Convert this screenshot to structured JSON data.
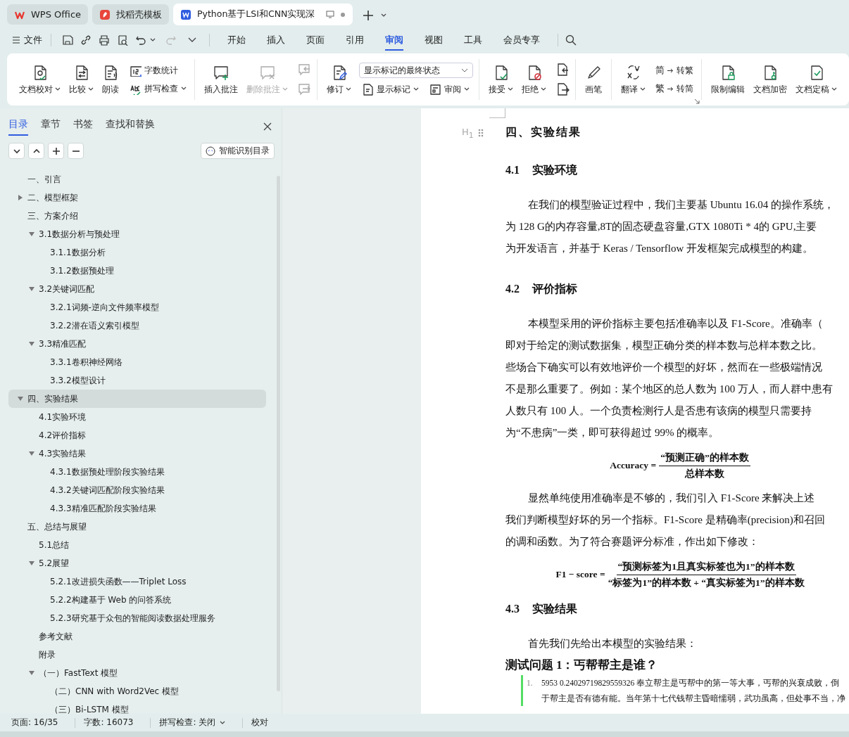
{
  "browser_tabs": [
    {
      "title": "WPS Office",
      "selected": false
    },
    {
      "title": "找稻壳模板",
      "selected": false
    },
    {
      "title": "Python基于LSI和CNN实现深",
      "selected": true
    }
  ],
  "menu": {
    "file": "文件",
    "tabs": [
      {
        "label": "开始",
        "selected": false
      },
      {
        "label": "插入",
        "selected": false
      },
      {
        "label": "页面",
        "selected": false
      },
      {
        "label": "引用",
        "selected": false
      },
      {
        "label": "审阅",
        "selected": true
      },
      {
        "label": "视图",
        "selected": false
      },
      {
        "label": "工具",
        "selected": false
      },
      {
        "label": "会员专享",
        "selected": false
      }
    ]
  },
  "ribbon": {
    "groups": [
      [
        {
          "kind": "large",
          "label": "文档校对",
          "dropdown": true,
          "disabled": false
        },
        {
          "kind": "large",
          "label": "比较",
          "dropdown": true,
          "disabled": false
        },
        {
          "kind": "large",
          "label": "朗读",
          "dropdown": false,
          "disabled": false
        },
        {
          "kind": "stack",
          "items": [
            {
              "label": "字数统计",
              "dropdown": false
            },
            {
              "label": "拼写检查",
              "dropdown": true
            }
          ]
        }
      ],
      [
        {
          "kind": "large",
          "label": "插入批注",
          "dropdown": false,
          "disabled": false
        },
        {
          "kind": "large",
          "label": "删除批注",
          "dropdown": true,
          "disabled": true
        },
        {
          "kind": "icons",
          "disabled": true
        }
      ],
      [
        {
          "kind": "large",
          "label": "修订",
          "dropdown": true,
          "disabled": false
        },
        {
          "kind": "select_stack",
          "value": "显示标记的最终状态",
          "items": [
            {
              "label": "显示标记",
              "dropdown": true
            },
            {
              "label": "审阅",
              "dropdown": true
            }
          ]
        }
      ],
      [
        {
          "kind": "large",
          "label": "接受",
          "dropdown": true,
          "disabled": false
        },
        {
          "kind": "large",
          "label": "拒绝",
          "dropdown": true,
          "disabled": false
        },
        {
          "kind": "icons",
          "disabled": false
        }
      ],
      [
        {
          "kind": "large",
          "label": "画笔",
          "dropdown": false,
          "disabled": false
        }
      ],
      [
        {
          "kind": "large",
          "label": "翻译",
          "dropdown": true,
          "disabled": false
        },
        {
          "kind": "stack",
          "items": [
            {
              "glyph": "简",
              "label": "转繁",
              "dropdown": false
            },
            {
              "glyph": "繁",
              "label": "转简",
              "dropdown": false
            }
          ]
        }
      ],
      [
        {
          "kind": "large",
          "label": "限制编辑",
          "dropdown": false,
          "disabled": false
        },
        {
          "kind": "large",
          "label": "文档加密",
          "dropdown": false,
          "disabled": false
        },
        {
          "kind": "large",
          "label": "文档定稿",
          "dropdown": true,
          "disabled": false
        }
      ]
    ]
  },
  "nav": {
    "tabs": [
      {
        "label": "目录",
        "selected": true
      },
      {
        "label": "章节",
        "selected": false
      },
      {
        "label": "书签",
        "selected": false
      },
      {
        "label": "查找和替换",
        "selected": false
      }
    ],
    "smart_button": "智能识别目录",
    "tree": [
      {
        "label": "一、引言",
        "selected": false
      },
      {
        "label": "二、模型框架",
        "selected": false,
        "expanded": false
      },
      {
        "label": "三、方案介绍",
        "selected": false,
        "children": [
          {
            "label": "3.1数据分析与预处理",
            "selected": false,
            "expanded": true,
            "children": [
              {
                "label": "3.1.1数据分析",
                "selected": false
              },
              {
                "label": "3.1.2数据预处理",
                "selected": false
              }
            ]
          },
          {
            "label": "3.2关键词匹配",
            "selected": false,
            "expanded": true,
            "children": [
              {
                "label": "3.2.1词频-逆向文件频率模型",
                "selected": false
              },
              {
                "label": "3.2.2潜在语义索引模型",
                "selected": false
              }
            ]
          },
          {
            "label": "3.3精准匹配",
            "selected": false,
            "expanded": true,
            "children": [
              {
                "label": "3.3.1卷积神经网络",
                "selected": false
              },
              {
                "label": "3.3.2模型设计",
                "selected": false
              }
            ]
          }
        ]
      },
      {
        "label": "四、实验结果",
        "selected": true,
        "expanded": true,
        "children": [
          {
            "label": "4.1实验环境",
            "selected": false
          },
          {
            "label": "4.2评价指标",
            "selected": false
          },
          {
            "label": "4.3实验结果",
            "selected": false,
            "expanded": true,
            "children": [
              {
                "label": "4.3.1数据预处理阶段实验结果",
                "selected": false
              },
              {
                "label": "4.3.2关键词匹配阶段实验结果",
                "selected": false
              },
              {
                "label": "4.3.3精准匹配阶段实验结果",
                "selected": false
              }
            ]
          }
        ]
      },
      {
        "label": "五、总结与展望",
        "selected": false,
        "children": [
          {
            "label": "5.1总结",
            "selected": false
          },
          {
            "label": "5.2展望",
            "selected": false,
            "expanded": true,
            "children": [
              {
                "label": "5.2.1改进损失函数——Triplet Loss",
                "selected": false
              },
              {
                "label": "5.2.2构建基于 Web 的问答系统",
                "selected": false
              },
              {
                "label": "5.2.3研究基于众包的智能阅读数据处理服务",
                "selected": false
              }
            ]
          },
          {
            "label": "参考文献",
            "selected": false
          },
          {
            "label": "附录",
            "selected": false
          },
          {
            "label": "（一）FastText 模型",
            "selected": false,
            "expanded": true,
            "children": [
              {
                "label": "（二）CNN with Word2Vec 模型",
                "selected": false
              },
              {
                "label": "（三）Bi-LSTM 模型",
                "selected": false
              }
            ]
          }
        ]
      }
    ]
  },
  "document": {
    "blocks": [
      {
        "kind": "h1",
        "marker": "H$_{1}$",
        "text": "四、实验结果"
      },
      {
        "kind": "h2",
        "number": "4.1",
        "text": "实验环境"
      },
      {
        "kind": "para",
        "lines": [
          "在我们的模型验证过程中，我们主要基 Ubuntu 16.04 的操作系统，",
          "为 128 G的内存容量,8T的固态硬盘容量,GTX 1080Ti * 4的 GPU,主要",
          "为开发语言，并基于 Keras / Tensorflow 开发框架完成模型的构建。"
        ]
      },
      {
        "kind": "h2",
        "number": "4.2",
        "text": "评价指标"
      },
      {
        "kind": "para",
        "lines": [
          "本模型采用的评价指标主要包括准确率以及 F1-Score。准确率（",
          "即对于给定的测试数据集，模型正确分类的样本数与总样本数之比。",
          "些场合下确实可以有效地评价一个模型的好坏，然而在一些极端情况",
          "不是那么重要了。例如：某个地区的总人数为 100 万人，而人群中患有",
          "人数只有  100 人。一个负责检测行人是否患有该病的模型只需要持",
          "为“不患病”一类，即可获得超过  99%  的概率。"
        ]
      },
      {
        "kind": "formula",
        "lhs": "Accuracy =",
        "numerator": "“预测正确”的样本数",
        "denominator": "总样本数"
      },
      {
        "kind": "para",
        "lines": [
          "显然单纯使用准确率是不够的，我们引入  F1-Score 来解决上述",
          "我们判断模型好坏的另一个指标。F1-Score 是精确率(precision)和召回",
          "的调和函数。为了符合赛题评分标准，作出如下修改："
        ]
      },
      {
        "kind": "formula",
        "lhs": "F1 − score =",
        "numerator": "“预测标签为1且真实标签也为1”的样本数",
        "denominator": "“标签为1”的样本数 + “真实标签为1”的样本数"
      },
      {
        "kind": "h2",
        "number": "4.3",
        "text": "实验结果"
      },
      {
        "kind": "para",
        "lines": [
          "首先我们先给出本模型的实验结果："
        ]
      },
      {
        "kind": "question",
        "text": "测试问题 1：丐帮帮主是谁？"
      },
      {
        "kind": "list_item",
        "marker": "1.",
        "revised": true,
        "lines": [
          "5953 0.24029719829559326 奉立帮主是丐帮中的第一等大事，丐帮的兴衰成败，倒",
          "于帮主是否有德有能。当年第十七代钱帮主昏暗懦弱，武功虽高，但处事不当，净"
        ]
      }
    ]
  },
  "status_bar": [
    {
      "text": "页面: 16/35",
      "dropdown": false
    },
    {
      "text": "字数: 16073",
      "dropdown": false
    },
    {
      "text": "拼写检查: 关闭",
      "dropdown": true
    },
    {
      "text": "校对",
      "dropdown": false
    }
  ]
}
